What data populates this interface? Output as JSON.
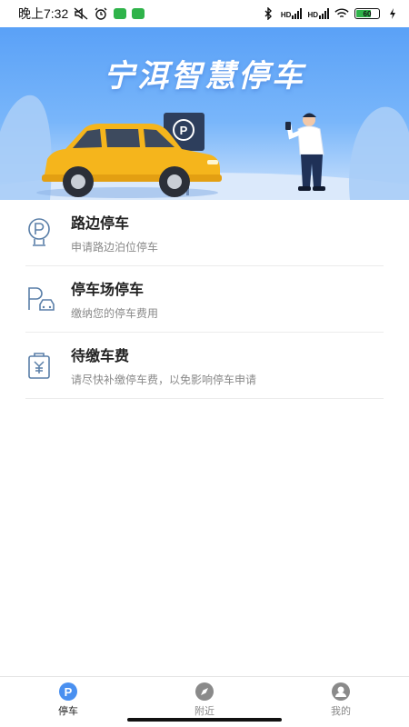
{
  "status_bar": {
    "time": "晚上7:32",
    "battery_level": "60",
    "network_1": "HD",
    "network_2": "HD"
  },
  "banner": {
    "title": "宁洱智慧停车",
    "parking_sign": "P"
  },
  "menu": {
    "items": [
      {
        "title": "路边停车",
        "subtitle": "申请路边泊位停车",
        "icon": "roadside-parking-icon"
      },
      {
        "title": "停车场停车",
        "subtitle": "缴纳您的停车费用",
        "icon": "parking-lot-icon"
      },
      {
        "title": "待缴车费",
        "subtitle": "请尽快补缴停车费，以免影响停车申请",
        "icon": "pending-fee-icon"
      }
    ]
  },
  "tabbar": {
    "tabs": [
      {
        "label": "停车",
        "icon": "parking-tab-icon",
        "active": true
      },
      {
        "label": "附近",
        "icon": "compass-icon",
        "active": false
      },
      {
        "label": "我的",
        "icon": "user-icon",
        "active": false
      }
    ]
  },
  "colors": {
    "accent": "#4a90f0",
    "icon_stroke": "#5a7fa8",
    "banner_top": "#5aa1f7",
    "car_body": "#f5b51c"
  }
}
